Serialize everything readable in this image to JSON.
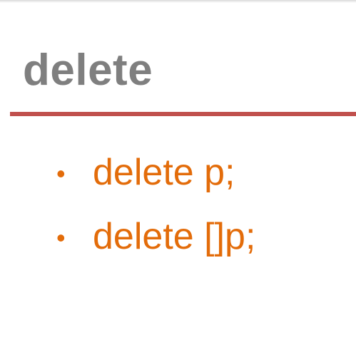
{
  "slide": {
    "title": "delete",
    "bullets": [
      {
        "marker": "•",
        "text": "delete p;"
      },
      {
        "marker": "•",
        "text": "delete []p;"
      }
    ]
  },
  "colors": {
    "title": "#7f7f7f",
    "rule": "#c0504d",
    "bullet_text": "#e36c0a",
    "background": "#ffffff"
  }
}
